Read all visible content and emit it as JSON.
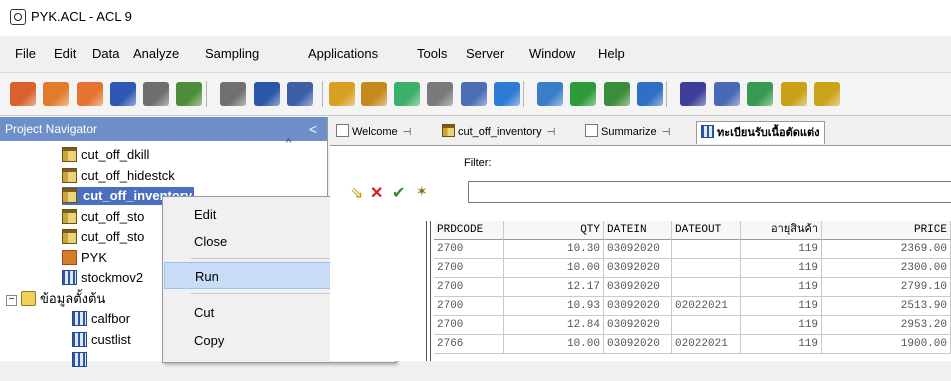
{
  "window": {
    "title": "PYK.ACL - ACL 9"
  },
  "menu": [
    "File",
    "Edit",
    "Data",
    "Analyze",
    "Sampling",
    "Applications",
    "Tools",
    "Server",
    "Window",
    "Help"
  ],
  "toolbar": {
    "buttons": [
      {
        "icon": "open-project-icon",
        "color": "#d9612b"
      },
      {
        "icon": "new-project-icon",
        "color": "#e07c2c"
      },
      {
        "icon": "import-icon",
        "color": "#e67332"
      },
      {
        "icon": "save-icon",
        "color": "#2e56b3"
      },
      {
        "icon": "print-icon",
        "color": "#6e6e6e"
      },
      {
        "icon": "user-icon",
        "color": "#4c8c3a"
      },
      {
        "icon": "refresh-icon",
        "color": "#707070"
      },
      {
        "icon": "table-view-icon",
        "color": "#2b57a8"
      },
      {
        "icon": "back-icon",
        "color": "#3d5fa8"
      },
      {
        "icon": "document-icon",
        "color": "#d6a024"
      },
      {
        "icon": "edit-icon",
        "color": "#c58a1b"
      },
      {
        "icon": "table-add-icon",
        "color": "#3bb06a"
      },
      {
        "icon": "table-edit-icon",
        "color": "#7a7a7a"
      },
      {
        "icon": "table-delete-icon",
        "color": "#4b6db3"
      },
      {
        "icon": "sort-icon",
        "color": "#2e7bd6"
      },
      {
        "icon": "beaker-icon",
        "color": "#3a7dc8"
      },
      {
        "icon": "chart-icon",
        "color": "#2f9a3a"
      },
      {
        "icon": "clock-icon",
        "color": "#3b8d3b"
      },
      {
        "icon": "percent-icon",
        "color": "#2f6fc4"
      },
      {
        "icon": "hierarchy-icon",
        "color": "#3d3d9a"
      },
      {
        "icon": "columns-icon",
        "color": "#4869b5"
      },
      {
        "icon": "join-icon",
        "color": "#389a52"
      },
      {
        "icon": "numbers-icon",
        "color": "#c9a017"
      },
      {
        "icon": "text-icon",
        "color": "#caa31a"
      }
    ]
  },
  "navigator": {
    "title": "Project Navigator",
    "collapse_glyph": "<",
    "items": [
      {
        "label": "cut_off_dkill",
        "icon": "table-icon",
        "indent": 1
      },
      {
        "label": "cut_off_hidestck",
        "icon": "table-icon",
        "indent": 1
      },
      {
        "label": "cut_off_inventory",
        "icon": "table-icon",
        "indent": 1,
        "selected": true
      },
      {
        "label": "cut_off_sto",
        "icon": "table-icon",
        "indent": 1
      },
      {
        "label": "cut_off_sto",
        "icon": "table-icon",
        "indent": 1
      },
      {
        "label": "PYK",
        "icon": "project-icon",
        "indent": 1
      },
      {
        "label": "stockmov2",
        "icon": "view-icon",
        "indent": 1
      },
      {
        "label": "ข้อมูลตั้งต้น",
        "icon": "folder-icon",
        "indent": 0,
        "expander": "−"
      },
      {
        "label": "calfbor",
        "icon": "view-icon",
        "indent": 2
      },
      {
        "label": "custlist",
        "icon": "view-icon",
        "indent": 2
      },
      {
        "label": "",
        "icon": "view-icon",
        "indent": 2
      }
    ]
  },
  "context_menu": {
    "items": [
      "Edit",
      "Close",
      "Run",
      "Cut",
      "Copy",
      ""
    ],
    "highlighted": "Run"
  },
  "tabs": [
    {
      "label": "Welcome",
      "icon": "page-icon",
      "active": false
    },
    {
      "label": "cut_off_inventory",
      "icon": "table-icon",
      "active": false
    },
    {
      "label": "Summarize",
      "icon": "page-icon",
      "active": false
    },
    {
      "label": "ทะเบียนรับเนื้อตัดแต่ง",
      "icon": "view-icon",
      "active": true
    }
  ],
  "filter": {
    "label": "Filter:",
    "value": ""
  },
  "grid": {
    "columns": [
      {
        "label": "PRDCODE",
        "align": "left"
      },
      {
        "label": "QTY",
        "align": "right"
      },
      {
        "label": "DATEIN",
        "align": "left"
      },
      {
        "label": "DATEOUT",
        "align": "left"
      },
      {
        "label": "อายุสินค้า",
        "align": "right"
      },
      {
        "label": "PRICE",
        "align": "right"
      }
    ],
    "rows": [
      [
        "2700",
        "10.30",
        "03092020",
        "",
        "119",
        "2369.00"
      ],
      [
        "2700",
        "10.00",
        "03092020",
        "",
        "119",
        "2300.00"
      ],
      [
        "2700",
        "12.17",
        "03092020",
        "",
        "119",
        "2799.10"
      ],
      [
        "2700",
        "10.93",
        "03092020",
        "02022021",
        "119",
        "2513.90"
      ],
      [
        "2700",
        "12.84",
        "03092020",
        "",
        "119",
        "2953.20"
      ],
      [
        "2766",
        "10.00",
        "03092020",
        "02022021",
        "119",
        "1900.00"
      ]
    ]
  }
}
